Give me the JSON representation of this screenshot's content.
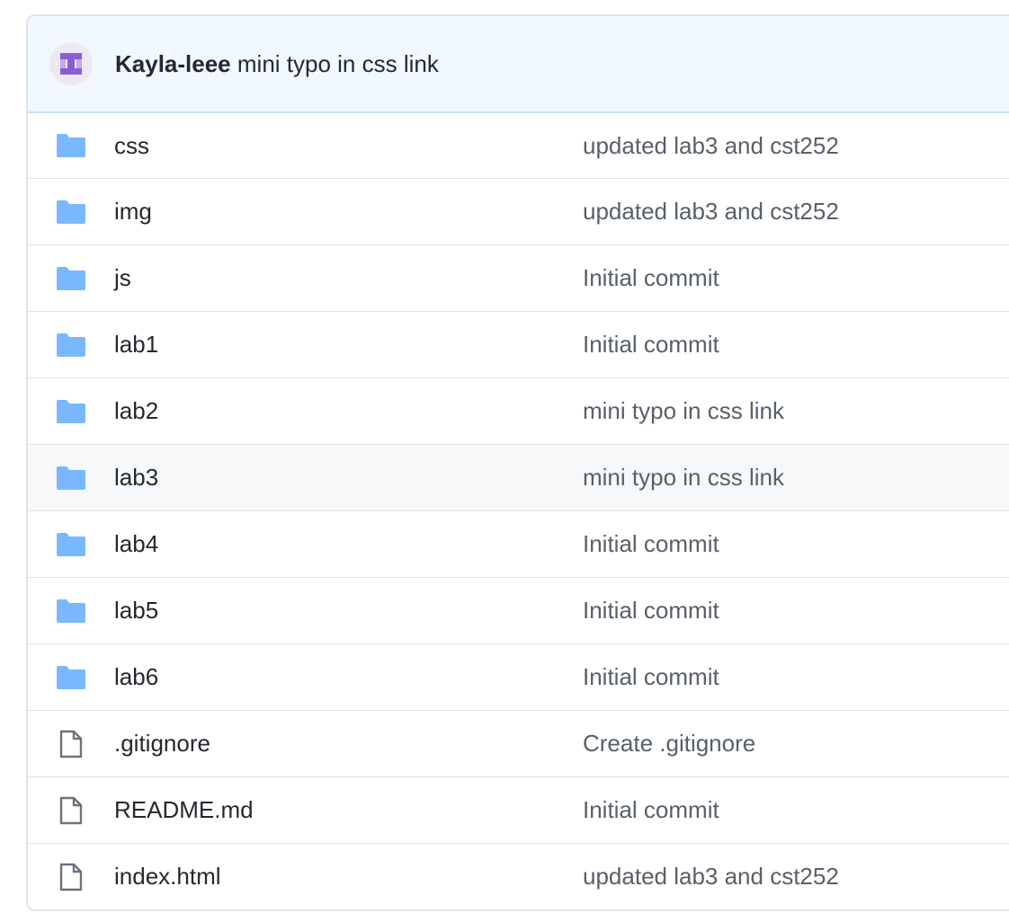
{
  "latest_commit": {
    "author": "Kayla-leee",
    "message": "mini typo in css link",
    "avatar_colors": {
      "background": "#ece9f4",
      "glyph": "#8a5cd6"
    }
  },
  "icon_colors": {
    "folder": "#79b8ff",
    "file": "#6a737d"
  },
  "rows": [
    {
      "type": "folder",
      "icon": "folder-icon",
      "name": "css",
      "message": "updated lab3 and cst252"
    },
    {
      "type": "folder",
      "icon": "folder-icon",
      "name": "img",
      "message": "updated lab3 and cst252"
    },
    {
      "type": "folder",
      "icon": "folder-icon",
      "name": "js",
      "message": "Initial commit"
    },
    {
      "type": "folder",
      "icon": "folder-icon",
      "name": "lab1",
      "message": "Initial commit"
    },
    {
      "type": "folder",
      "icon": "folder-icon",
      "name": "lab2",
      "message": "mini typo in css link"
    },
    {
      "type": "folder",
      "icon": "folder-icon",
      "name": "lab3",
      "message": "mini typo in css link",
      "hovered": true
    },
    {
      "type": "folder",
      "icon": "folder-icon",
      "name": "lab4",
      "message": "Initial commit"
    },
    {
      "type": "folder",
      "icon": "folder-icon",
      "name": "lab5",
      "message": "Initial commit"
    },
    {
      "type": "folder",
      "icon": "folder-icon",
      "name": "lab6",
      "message": "Initial commit"
    },
    {
      "type": "file",
      "icon": "file-icon",
      "name": ".gitignore",
      "message": "Create .gitignore"
    },
    {
      "type": "file",
      "icon": "file-icon",
      "name": "README.md",
      "message": "Initial commit"
    },
    {
      "type": "file",
      "icon": "file-icon",
      "name": "index.html",
      "message": "updated lab3 and cst252"
    }
  ]
}
